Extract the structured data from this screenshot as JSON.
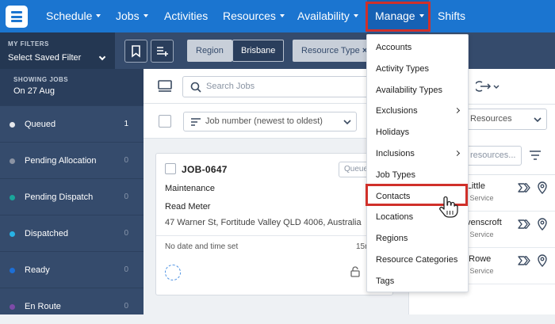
{
  "nav": {
    "items": [
      {
        "label": "Schedule",
        "caret": true
      },
      {
        "label": "Jobs",
        "caret": true
      },
      {
        "label": "Activities",
        "caret": false
      },
      {
        "label": "Resources",
        "caret": true
      },
      {
        "label": "Availability",
        "caret": true
      },
      {
        "label": "Manage",
        "caret": true
      },
      {
        "label": "Shifts",
        "caret": false
      }
    ],
    "active": "Manage"
  },
  "sidebar": {
    "filters_label": "MY FILTERS",
    "filters_value": "Select Saved Filter",
    "showing_label": "SHOWING JOBS",
    "showing_date": "On 27 Aug",
    "statuses": [
      {
        "name": "Queued",
        "count": "1",
        "color": "#e5e7eb"
      },
      {
        "name": "Pending Allocation",
        "count": "0",
        "color": "#8b93a3"
      },
      {
        "name": "Pending Dispatch",
        "count": "0",
        "color": "#1aa59a"
      },
      {
        "name": "Dispatched",
        "count": "0",
        "color": "#27b3e6"
      },
      {
        "name": "Ready",
        "count": "0",
        "color": "#1d6fd6"
      },
      {
        "name": "En Route",
        "count": "0",
        "color": "#7d4ba8"
      }
    ]
  },
  "filterbar": {
    "region_label": "Region",
    "region_value": "Brisbane",
    "resource_type_label": "Resource Type",
    "resource_type_close": "×"
  },
  "jobs": {
    "search_placeholder": "Search Jobs",
    "sort_label": "Job number (newest to oldest)",
    "card": {
      "number": "JOB-0647",
      "status_pill": "Queue",
      "type": "Maintenance",
      "title": "Read Meter",
      "address": "47 Warner St, Fortitude Valley QLD 4006, Australia",
      "date_text": "No date and time set",
      "duration": "15m"
    }
  },
  "resources": {
    "type_select": "Resources",
    "search_placeholder": "resources...",
    "list": [
      {
        "name": "r Little",
        "sub": "er Service"
      },
      {
        "name": "avenscroft",
        "sub": "er Service"
      },
      {
        "name": "a Rowe",
        "sub": "er Service"
      }
    ]
  },
  "manage_menu": {
    "items": [
      {
        "label": "Accounts",
        "submenu": false
      },
      {
        "label": "Activity Types",
        "submenu": false
      },
      {
        "label": "Availability Types",
        "submenu": false
      },
      {
        "label": "Exclusions",
        "submenu": true
      },
      {
        "label": "Holidays",
        "submenu": false
      },
      {
        "label": "Inclusions",
        "submenu": true
      },
      {
        "label": "Job Types",
        "submenu": false
      },
      {
        "label": "Contacts",
        "submenu": false
      },
      {
        "label": "Locations",
        "submenu": false
      },
      {
        "label": "Regions",
        "submenu": false
      },
      {
        "label": "Resource Categories",
        "submenu": false
      },
      {
        "label": "Tags",
        "submenu": false
      }
    ],
    "highlighted": "Contacts"
  },
  "colors": {
    "nav_bg": "#1b75d0",
    "sidebar_bg": "#354b6c",
    "highlight": "#d0302a"
  }
}
